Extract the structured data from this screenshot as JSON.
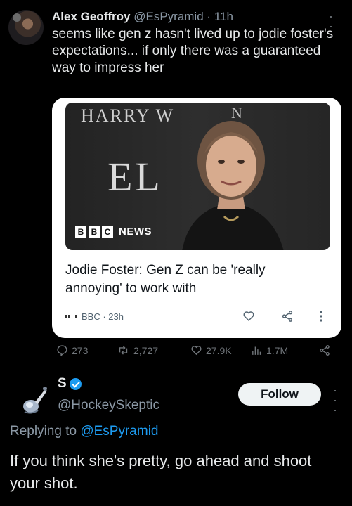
{
  "tweet": {
    "author_name": "Alex Geoffroy",
    "author_handle": "@EsPyramid",
    "separator": "·",
    "time": "11h",
    "text": "seems like gen z hasn't lived up to jodie foster's expectations... if only there was a guaranteed way to impress her",
    "card": {
      "image_text_top": "HARRY W",
      "image_text_mid": "EL",
      "image_text_right": "N",
      "brand_letters": [
        "B",
        "B",
        "C"
      ],
      "brand_news": "NEWS",
      "title": "Jodie Foster: Gen Z can be 'really annoying' to work with",
      "source": "BBC · 23h"
    },
    "stats": {
      "replies": "273",
      "reposts": "2,727",
      "likes": "27.9K",
      "views": "1.7M"
    }
  },
  "reply": {
    "author_name": "S",
    "author_handle": "@HockeySkeptic",
    "follow_label": "Follow",
    "replying_prefix": "Replying to",
    "replying_handle": "@EsPyramid",
    "text": "If you think she's pretty, go ahead and shoot your shot."
  },
  "colors": {
    "background": "#000000",
    "text": "#e7e9ea",
    "muted": "#71767b",
    "accent": "#1d9bf0"
  }
}
